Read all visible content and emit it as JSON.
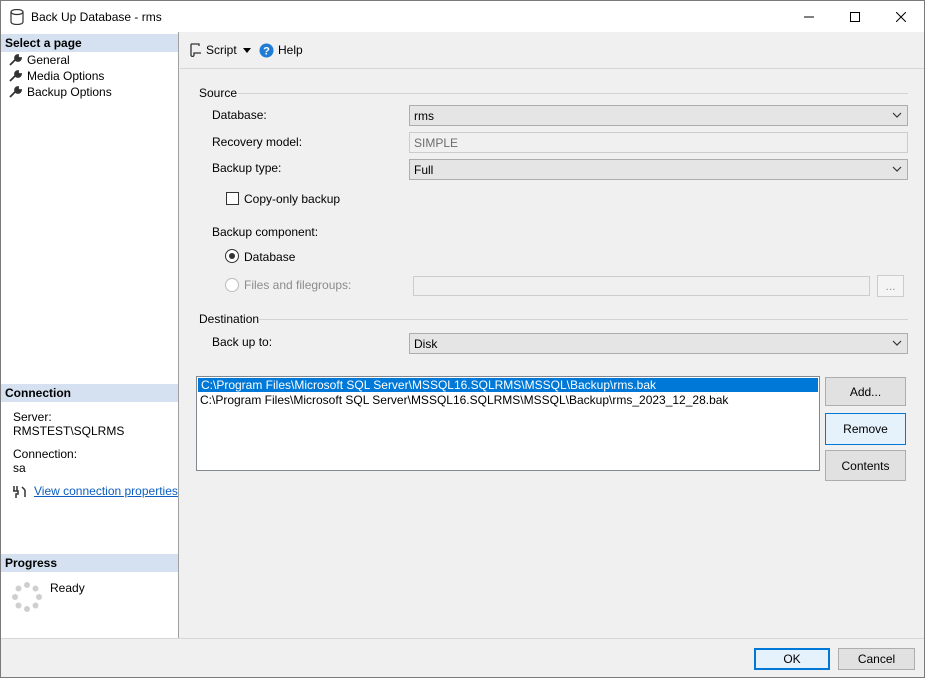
{
  "window": {
    "title": "Back Up Database - rms"
  },
  "left": {
    "select_page_header": "Select a page",
    "pages": [
      "General",
      "Media Options",
      "Backup Options"
    ],
    "connection_header": "Connection",
    "server_label": "Server:",
    "server_value": "RMSTEST\\SQLRMS",
    "connection_label": "Connection:",
    "connection_value": "sa",
    "view_connection_link": "View connection properties",
    "progress_header": "Progress",
    "progress_status": "Ready"
  },
  "toolbar": {
    "script_label": "Script",
    "help_label": "Help"
  },
  "source": {
    "group_label": "Source",
    "database_label": "Database:",
    "database_value": "rms",
    "recovery_label": "Recovery model:",
    "recovery_value": "SIMPLE",
    "backup_type_label": "Backup type:",
    "backup_type_value": "Full",
    "copy_only_label": "Copy-only backup",
    "component_label": "Backup component:",
    "component_database": "Database",
    "component_files": "Files and filegroups:",
    "browse_label": "..."
  },
  "destination": {
    "group_label": "Destination",
    "backup_to_label": "Back up to:",
    "backup_to_value": "Disk",
    "files": [
      "C:\\Program Files\\Microsoft SQL Server\\MSSQL16.SQLRMS\\MSSQL\\Backup\\rms.bak",
      "C:\\Program Files\\Microsoft SQL Server\\MSSQL16.SQLRMS\\MSSQL\\Backup\\rms_2023_12_28.bak"
    ],
    "add_label": "Add...",
    "remove_label": "Remove",
    "contents_label": "Contents"
  },
  "footer": {
    "ok_label": "OK",
    "cancel_label": "Cancel"
  }
}
